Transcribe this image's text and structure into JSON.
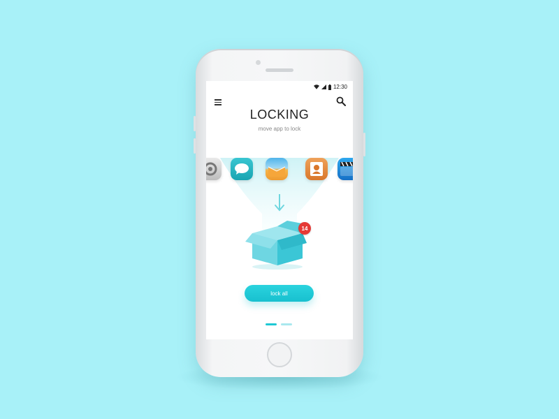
{
  "status_bar": {
    "time": "12:30",
    "wifi_icon": "wifi-icon",
    "signal_icon": "signal-icon",
    "battery_icon": "battery-icon"
  },
  "header": {
    "menu_icon": "hamburger-menu-icon",
    "search_icon": "search-icon",
    "title": "LOCKING",
    "subtitle": "move app to lock"
  },
  "apps": [
    {
      "icon": "settings-app-icon",
      "color": "#c9c9c9"
    },
    {
      "icon": "messages-app-icon",
      "color": "#2fbac7"
    },
    {
      "icon": "mail-app-icon",
      "color": "#f2a34a"
    },
    {
      "icon": "contacts-app-icon",
      "color": "#e58b3c"
    },
    {
      "icon": "video-app-icon",
      "color": "#1f8fd8"
    }
  ],
  "box": {
    "icon": "open-box-icon",
    "badge_count": "14"
  },
  "action": {
    "lock_all_label": "lock all"
  },
  "pager": {
    "page_count": 2,
    "active_page": 1
  },
  "colors": {
    "background": "#a8f1f8",
    "accent": "#1fc8d4",
    "badge": "#e53935"
  }
}
